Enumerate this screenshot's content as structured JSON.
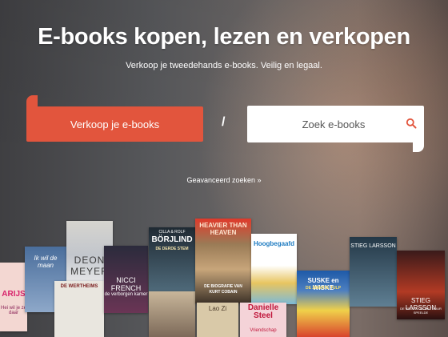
{
  "hero": {
    "title": "E-books kopen, lezen en verkopen",
    "subtitle": "Verkoop je tweedehands e-books. Veilig en legaal."
  },
  "actions": {
    "sell_label": "Verkoop je e-books",
    "separator": "/",
    "search_placeholder": "Zoek e-books",
    "advanced_label": "Geavanceerd zoeken »"
  },
  "colors": {
    "accent": "#e2553d",
    "text_on_hero": "#ffffff"
  },
  "books": [
    {
      "title": "ARIJS",
      "sub": "Hei wil je ze daar"
    },
    {
      "title": "Ik wil de maan",
      "sub": ""
    },
    {
      "title": "DEON MEYER",
      "sub": ""
    },
    {
      "title": "DE WERTHEIMS",
      "sub": ""
    },
    {
      "title": "NICCI FRENCH",
      "sub": "de verborgen kamer"
    },
    {
      "title": "BÖRJLIND",
      "sub": "DE DERDE STEM",
      "author_small": "CILLA & ROLF"
    },
    {
      "title": "HEAVIER THAN HEAVEN",
      "sub": "DE BIOGRAFIE VAN KURT COBAIN"
    },
    {
      "title": "Hoogbegaafd",
      "sub": ""
    },
    {
      "title": "SUSKE en WISKE",
      "sub": "DE ZWARTE TULP"
    },
    {
      "title": "STIEG LARSSON",
      "sub": ""
    },
    {
      "title": "Danielle Steel",
      "sub": "Vriendschap"
    },
    {
      "title": "STIEG LARSSON",
      "sub": "DE VROUW DIE MET VUUR SPEELDE"
    },
    {
      "title": "Lao Zi",
      "sub": ""
    }
  ]
}
